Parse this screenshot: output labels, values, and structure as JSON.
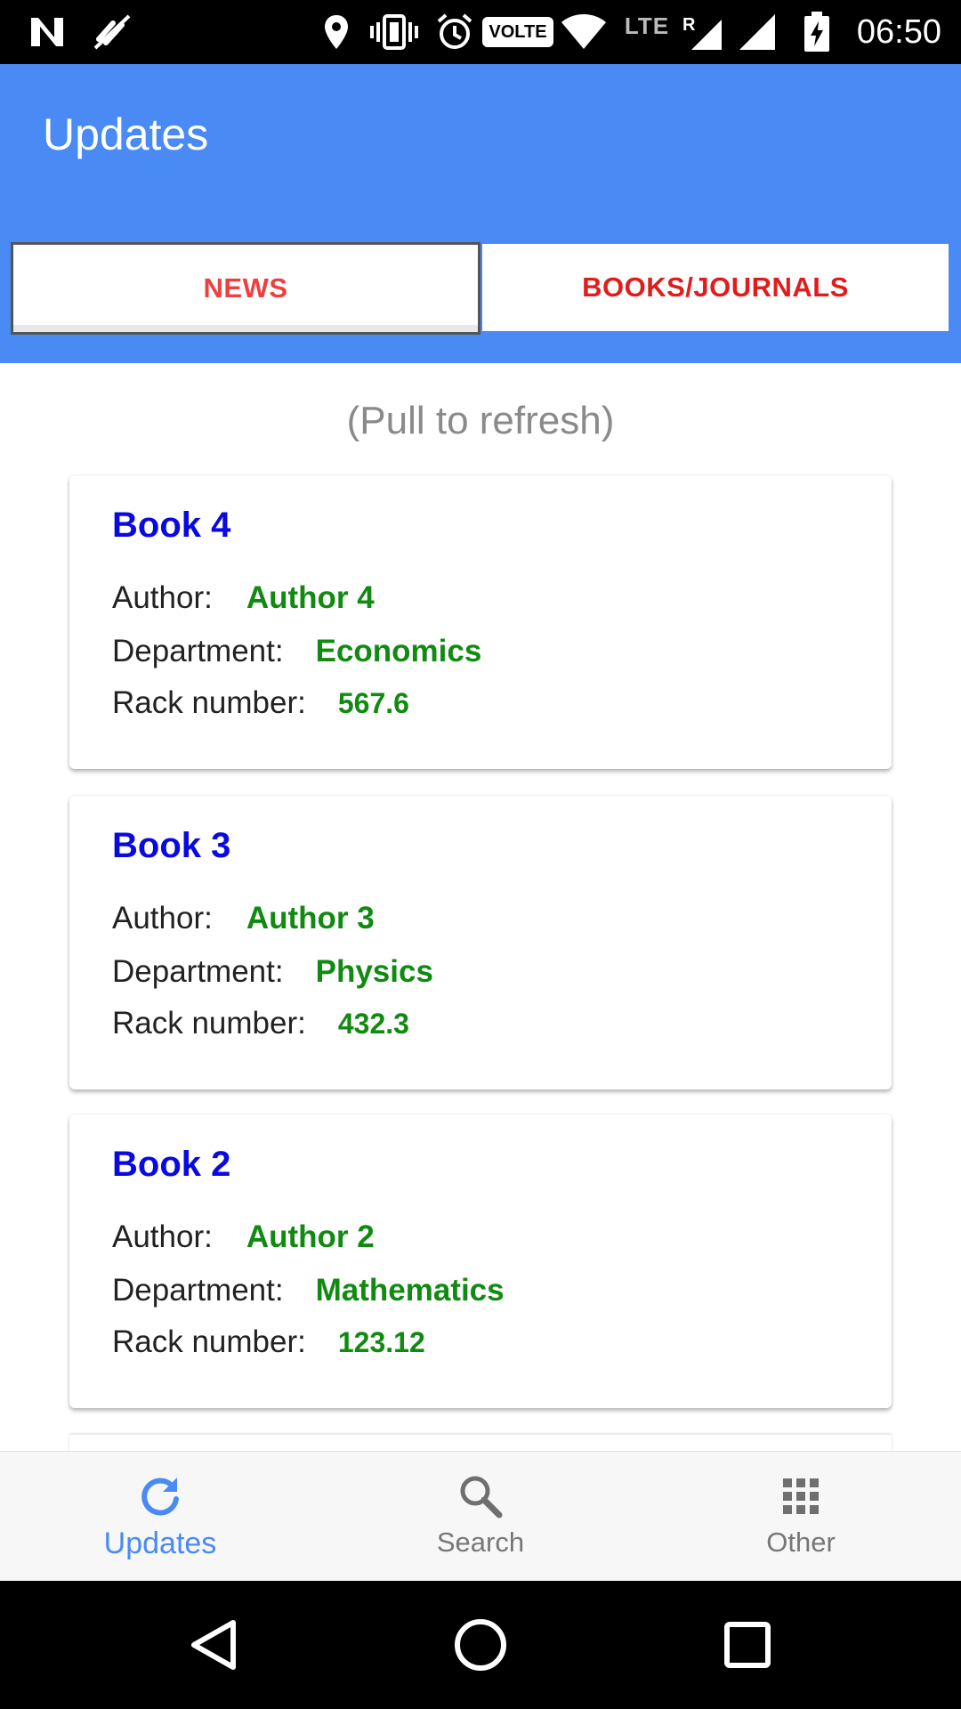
{
  "status_bar": {
    "time": "06:50",
    "volte": "VOLTE",
    "lte": "LTE",
    "roaming": "R"
  },
  "app_bar": {
    "title": "Updates",
    "tabs": [
      {
        "label": "NEWS",
        "selected": true
      },
      {
        "label": "BOOKS/JOURNALS",
        "selected": false
      }
    ]
  },
  "content": {
    "pull_hint": "(Pull to refresh)",
    "books": [
      {
        "title": "Book 4",
        "author_label": "Author:",
        "author": "Author 4",
        "department_label": "Department:",
        "department": "Economics",
        "rack_label": "Rack number:",
        "rack": "567.6"
      },
      {
        "title": "Book 3",
        "author_label": "Author:",
        "author": "Author 3",
        "department_label": "Department:",
        "department": "Physics",
        "rack_label": "Rack number:",
        "rack": "432.3"
      },
      {
        "title": "Book 2",
        "author_label": "Author:",
        "author": "Author 2",
        "department_label": "Department:",
        "department": "Mathematics",
        "rack_label": "Rack number:",
        "rack": "123.12"
      }
    ]
  },
  "bottom_nav": {
    "items": [
      {
        "label": "Updates",
        "icon": "refresh-icon",
        "active": true
      },
      {
        "label": "Search",
        "icon": "search-icon",
        "active": false
      },
      {
        "label": "Other",
        "icon": "grid-icon",
        "active": false
      }
    ]
  },
  "colors": {
    "primary": "#4a8af4",
    "tab_text": "#e01c1c",
    "title_blue": "#0a0ae0",
    "value_green": "#118a11"
  }
}
